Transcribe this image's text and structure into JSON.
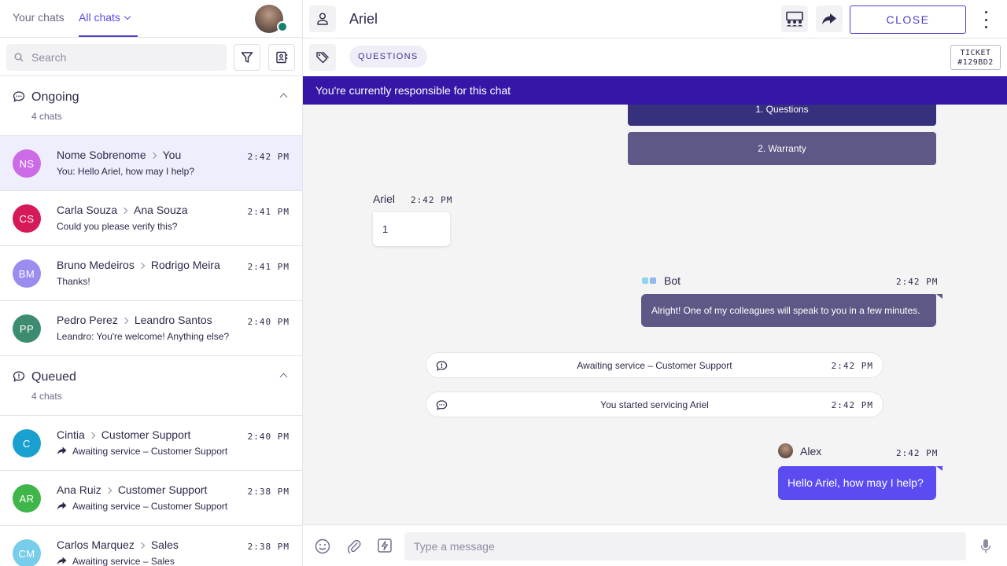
{
  "left_panel": {
    "tabs": {
      "your_chats": "Your chats",
      "all_chats": "All chats"
    },
    "search": {
      "placeholder": "Search"
    },
    "ongoing": {
      "title": "Ongoing",
      "count": "4 chats",
      "chats": [
        {
          "initials": "NS",
          "color": "#cb6ce6",
          "from": "Nome Sobrenome",
          "to": "You",
          "preview": "You: Hello Ariel, how may I help?",
          "time": "2:42 PM",
          "selected": true
        },
        {
          "initials": "CS",
          "color": "#d61a57",
          "from": "Carla Souza",
          "to": "Ana Souza",
          "preview": "Could you please verify this?",
          "time": "2:41 PM"
        },
        {
          "initials": "BM",
          "color": "#9b8cf0",
          "from": "Bruno Medeiros",
          "to": "Rodrigo Meira",
          "preview": "Thanks!",
          "time": "2:41 PM"
        },
        {
          "initials": "PP",
          "color": "#3d8c70",
          "from": "Pedro Perez",
          "to": "Leandro Santos",
          "preview": "Leandro: You're welcome! Anything else?",
          "time": "2:40 PM"
        }
      ]
    },
    "queued": {
      "title": "Queued",
      "count": "4 chats",
      "chats": [
        {
          "initials": "C",
          "color": "#1aa0cf",
          "from": "Cintia",
          "to": "Customer Support",
          "preview": "Awaiting service – Customer Support",
          "time": "2:40 PM"
        },
        {
          "initials": "AR",
          "color": "#3fb54a",
          "from": "Ana Ruiz",
          "to": "Customer Support",
          "preview": "Awaiting service – Customer Support",
          "time": "2:38 PM"
        },
        {
          "initials": "CM",
          "color": "#77cdea",
          "from": "Carlos Marquez",
          "to": "Sales",
          "preview": "Awaiting service – Sales",
          "time": "2:38 PM"
        }
      ]
    }
  },
  "header": {
    "contact_name": "Ariel",
    "close_label": "CLOSE",
    "tag": "QUESTIONS",
    "ticket_label": "TICKET",
    "ticket_id": "#129BD2"
  },
  "banner": {
    "text": "You're currently responsible for this chat"
  },
  "conversation": {
    "options": [
      "1. Questions",
      "2. Warranty"
    ],
    "ariel_msg": {
      "name": "Ariel",
      "time": "2:42 PM",
      "text": "1"
    },
    "bot_msg": {
      "name": "Bot",
      "time": "2:42 PM",
      "text": "Alright! One of my colleagues will speak to you in a few minutes."
    },
    "system_events": [
      {
        "text": "Awaiting service – Customer Support",
        "time": "2:42 PM"
      },
      {
        "text": "You started servicing Ariel",
        "time": "2:42 PM"
      }
    ],
    "agent_msg": {
      "name": "Alex",
      "time": "2:42 PM",
      "text": "Hello Ariel, how may I help?"
    }
  },
  "composer": {
    "placeholder": "Type a message"
  },
  "colors": {
    "accent": "#4b3fc7",
    "banner": "#3516a6",
    "agent_bubble": "#5b4cf2",
    "bot_bubble": "#5e5886"
  },
  "icons": [
    "search-icon",
    "filter-icon",
    "contacts-icon",
    "chat-bubble-icon",
    "user-icon",
    "transfer-group-icon",
    "forward-icon",
    "more-vertical-icon",
    "tag-icon",
    "emoji-icon",
    "attachment-icon",
    "quick-reply-icon",
    "microphone-icon"
  ]
}
